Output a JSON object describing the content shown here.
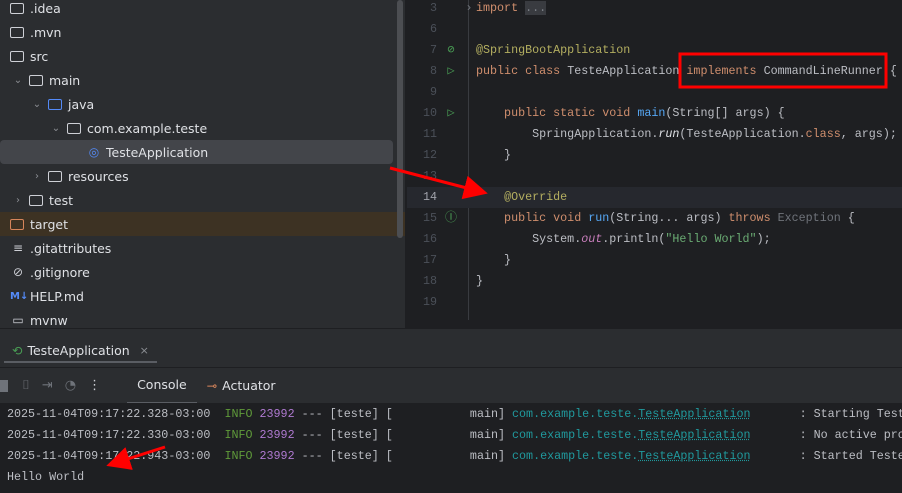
{
  "tree": [
    {
      "label": ".idea",
      "depth": 0,
      "icon": "folder",
      "chev": ""
    },
    {
      "label": ".mvn",
      "depth": 0,
      "icon": "folder",
      "chev": ""
    },
    {
      "label": "src",
      "depth": 0,
      "icon": "folder",
      "chev": ""
    },
    {
      "label": "main",
      "depth": 1,
      "icon": "folder",
      "chev": "open"
    },
    {
      "label": "java",
      "depth": 2,
      "icon": "folder-blue",
      "chev": "open"
    },
    {
      "label": "com.example.teste",
      "depth": 3,
      "icon": "package",
      "chev": "open"
    },
    {
      "label": "TesteApplication",
      "depth": 4,
      "icon": "spring-class",
      "chev": "",
      "selected": true
    },
    {
      "label": "resources",
      "depth": 2,
      "icon": "resources-folder",
      "chev": "closed"
    },
    {
      "label": "test",
      "depth": 1,
      "icon": "folder",
      "chev": "closed"
    },
    {
      "label": "target",
      "depth": 0,
      "icon": "folder-orange",
      "chev": "",
      "excluded": true
    },
    {
      "label": ".gitattributes",
      "depth": 0,
      "icon": "text-file",
      "chev": ""
    },
    {
      "label": ".gitignore",
      "depth": 0,
      "icon": "ignore-file",
      "chev": ""
    },
    {
      "label": "HELP.md",
      "depth": 0,
      "icon": "markdown-file",
      "chev": ""
    },
    {
      "label": "mvnw",
      "depth": 0,
      "icon": "terminal-file",
      "chev": ""
    }
  ],
  "code": [
    {
      "n": "3",
      "tokens": [
        [
          "import",
          "k"
        ],
        [
          " ",
          ""
        ],
        [
          "...",
          "fold"
        ]
      ],
      "fold": true
    },
    {
      "n": "6",
      "tokens": []
    },
    {
      "n": "7",
      "gutter": "spring-bean-icon",
      "tokens": [
        [
          "@SpringBootApplication",
          "a"
        ]
      ]
    },
    {
      "n": "8",
      "gutter": "run-icon",
      "tokens": [
        [
          "public class ",
          "k"
        ],
        [
          "TesteApplication ",
          "n"
        ],
        [
          "implements ",
          "k"
        ],
        [
          "CommandLineRunner ",
          "n"
        ],
        [
          "{",
          "n"
        ]
      ]
    },
    {
      "n": "9",
      "tokens": []
    },
    {
      "n": "10",
      "gutter": "run-icon",
      "tokens": [
        [
          "    public static void ",
          "k"
        ],
        [
          "main",
          "f"
        ],
        [
          "(String[] args) {",
          "n"
        ]
      ]
    },
    {
      "n": "11",
      "tokens": [
        [
          "        SpringApplication.",
          "n"
        ],
        [
          "run",
          "it"
        ],
        [
          "(TesteApplication.",
          "n"
        ],
        [
          "class",
          "k"
        ],
        [
          ", args);",
          "n"
        ]
      ]
    },
    {
      "n": "12",
      "tokens": [
        [
          "    }",
          "n"
        ]
      ]
    },
    {
      "n": "13",
      "tokens": []
    },
    {
      "n": "14",
      "current": true,
      "tokens": [
        [
          "    ",
          ""
        ],
        [
          "@Override",
          "a"
        ]
      ]
    },
    {
      "n": "15",
      "gutter": "implements-method-icon",
      "tokens": [
        [
          "    public void ",
          "k"
        ],
        [
          "run",
          "f"
        ],
        [
          "(String... args) ",
          "n"
        ],
        [
          "throws ",
          "k"
        ],
        [
          "Exception ",
          "g"
        ],
        [
          "{",
          "n"
        ]
      ]
    },
    {
      "n": "16",
      "tokens": [
        [
          "        System.",
          "n"
        ],
        [
          "out",
          "i"
        ],
        [
          ".println(",
          "n"
        ],
        [
          "\"Hello World\"",
          "s"
        ],
        [
          ");",
          "n"
        ]
      ]
    },
    {
      "n": "17",
      "tokens": [
        [
          "    }",
          "n"
        ]
      ]
    },
    {
      "n": "18",
      "tokens": [
        [
          "}",
          "n"
        ]
      ]
    },
    {
      "n": "19",
      "tokens": []
    }
  ],
  "run_tab": {
    "label": "TesteApplication",
    "close": "×"
  },
  "toolbar": {
    "tabs": [
      {
        "label": "Console",
        "active": true
      },
      {
        "label": "Actuator",
        "active": false
      }
    ]
  },
  "console": {
    "logs": [
      {
        "ts": "2025-11-04T09:17:22.328-03:00",
        "level": "INFO",
        "pid": "23992",
        "mid": " --- [teste] [           main] ",
        "pkg": "com.example.teste.",
        "cls": "TesteApplication",
        "msg": "       : Starting Test"
      },
      {
        "ts": "2025-11-04T09:17:22.330-03:00",
        "level": "INFO",
        "pid": "23992",
        "mid": " --- [teste] [           main] ",
        "pkg": "com.example.teste.",
        "cls": "TesteApplication",
        "msg": "       : No active pro"
      },
      {
        "ts": "2025-11-04T09:17:22.943-03:00",
        "level": "INFO",
        "pid": "23992",
        "mid": " --- [teste] [           main] ",
        "pkg": "com.example.teste.",
        "cls": "TesteApplication",
        "msg": "       : Started Teste"
      }
    ],
    "output": "Hello World"
  },
  "annotation_color": "#ff0000"
}
